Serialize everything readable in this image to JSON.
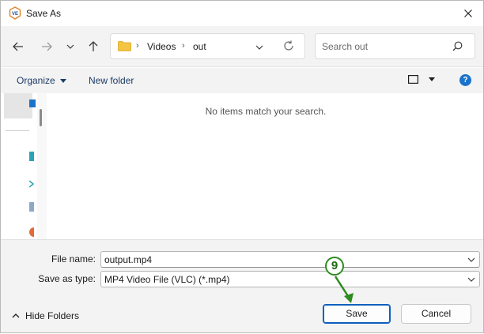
{
  "window": {
    "title": "Save As"
  },
  "address": {
    "crumbs": [
      "Videos",
      "out"
    ]
  },
  "search": {
    "placeholder": "Search out"
  },
  "toolbar": {
    "organize_label": "Organize",
    "new_folder_label": "New folder",
    "help_label": "?"
  },
  "content": {
    "empty_message": "No items match your search."
  },
  "form": {
    "file_name_label": "File name:",
    "file_name_value": "output.mp4",
    "save_type_label": "Save as type:",
    "save_type_value": "MP4 Video File (VLC) (*.mp4)"
  },
  "footer": {
    "hide_folders_label": "Hide Folders",
    "save_label": "Save",
    "cancel_label": "Cancel"
  },
  "annotation": {
    "step_number": "9"
  },
  "colors": {
    "accent": "#0f5fbf",
    "annotation_green": "#2e8b1f",
    "folder_yellow": "#f4c542",
    "help_blue": "#1a73c9"
  }
}
